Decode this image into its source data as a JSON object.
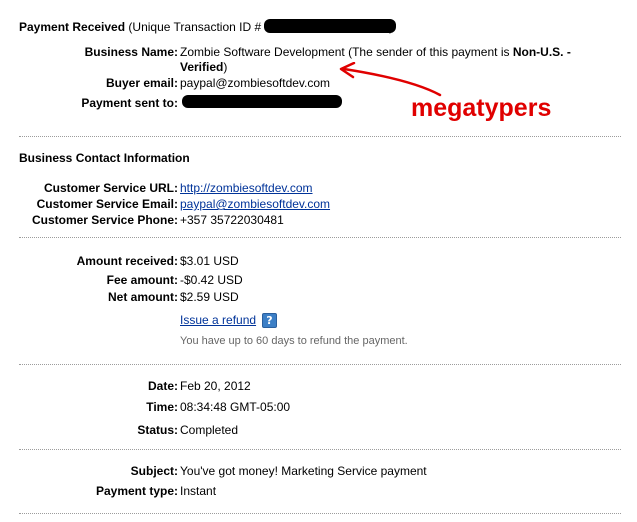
{
  "header": {
    "title": "Payment Received",
    "txn_prefix": "(Unique Transaction ID #",
    "txn_suffix": ")"
  },
  "sender": {
    "business_name_label": "Business Name:",
    "business_name_value_line1": "Zombie Software Development (The sender of this payment is ",
    "business_name_status": "Non-U.S. -",
    "business_name_value_line2": "Verified",
    "business_name_close": ")",
    "buyer_email_label": "Buyer email:",
    "buyer_email_value": "paypal@zombiesoftdev.com",
    "payment_sent_to_label": "Payment sent to:"
  },
  "annotation": {
    "text": "megatypers",
    "color": "#e00000"
  },
  "business_contact": {
    "title": "Business Contact Information",
    "url_label": "Customer Service URL:",
    "url_value": "http://zombiesoftdev.com",
    "email_label": "Customer Service Email:",
    "email_value": "paypal@zombiesoftdev.com",
    "phone_label": "Customer Service Phone:",
    "phone_value": "+357 35722030481"
  },
  "amounts": {
    "received_label": "Amount received:",
    "received_value": "$3.01 USD",
    "fee_label": "Fee amount:",
    "fee_value": "-$0.42 USD",
    "net_label": "Net amount:",
    "net_value": "$2.59 USD",
    "refund_link": "Issue a refund",
    "refund_help": "?",
    "refund_note": "You have up to 60 days to refund the payment."
  },
  "details": {
    "date_label": "Date:",
    "date_value": "Feb 20, 2012",
    "time_label": "Time:",
    "time_value": "08:34:48 GMT-05:00",
    "status_label": "Status:",
    "status_value": "Completed"
  },
  "message": {
    "subject_label": "Subject:",
    "subject_value": "You've got money! Marketing Service payment",
    "payment_type_label": "Payment type:",
    "payment_type_value": "Instant"
  }
}
